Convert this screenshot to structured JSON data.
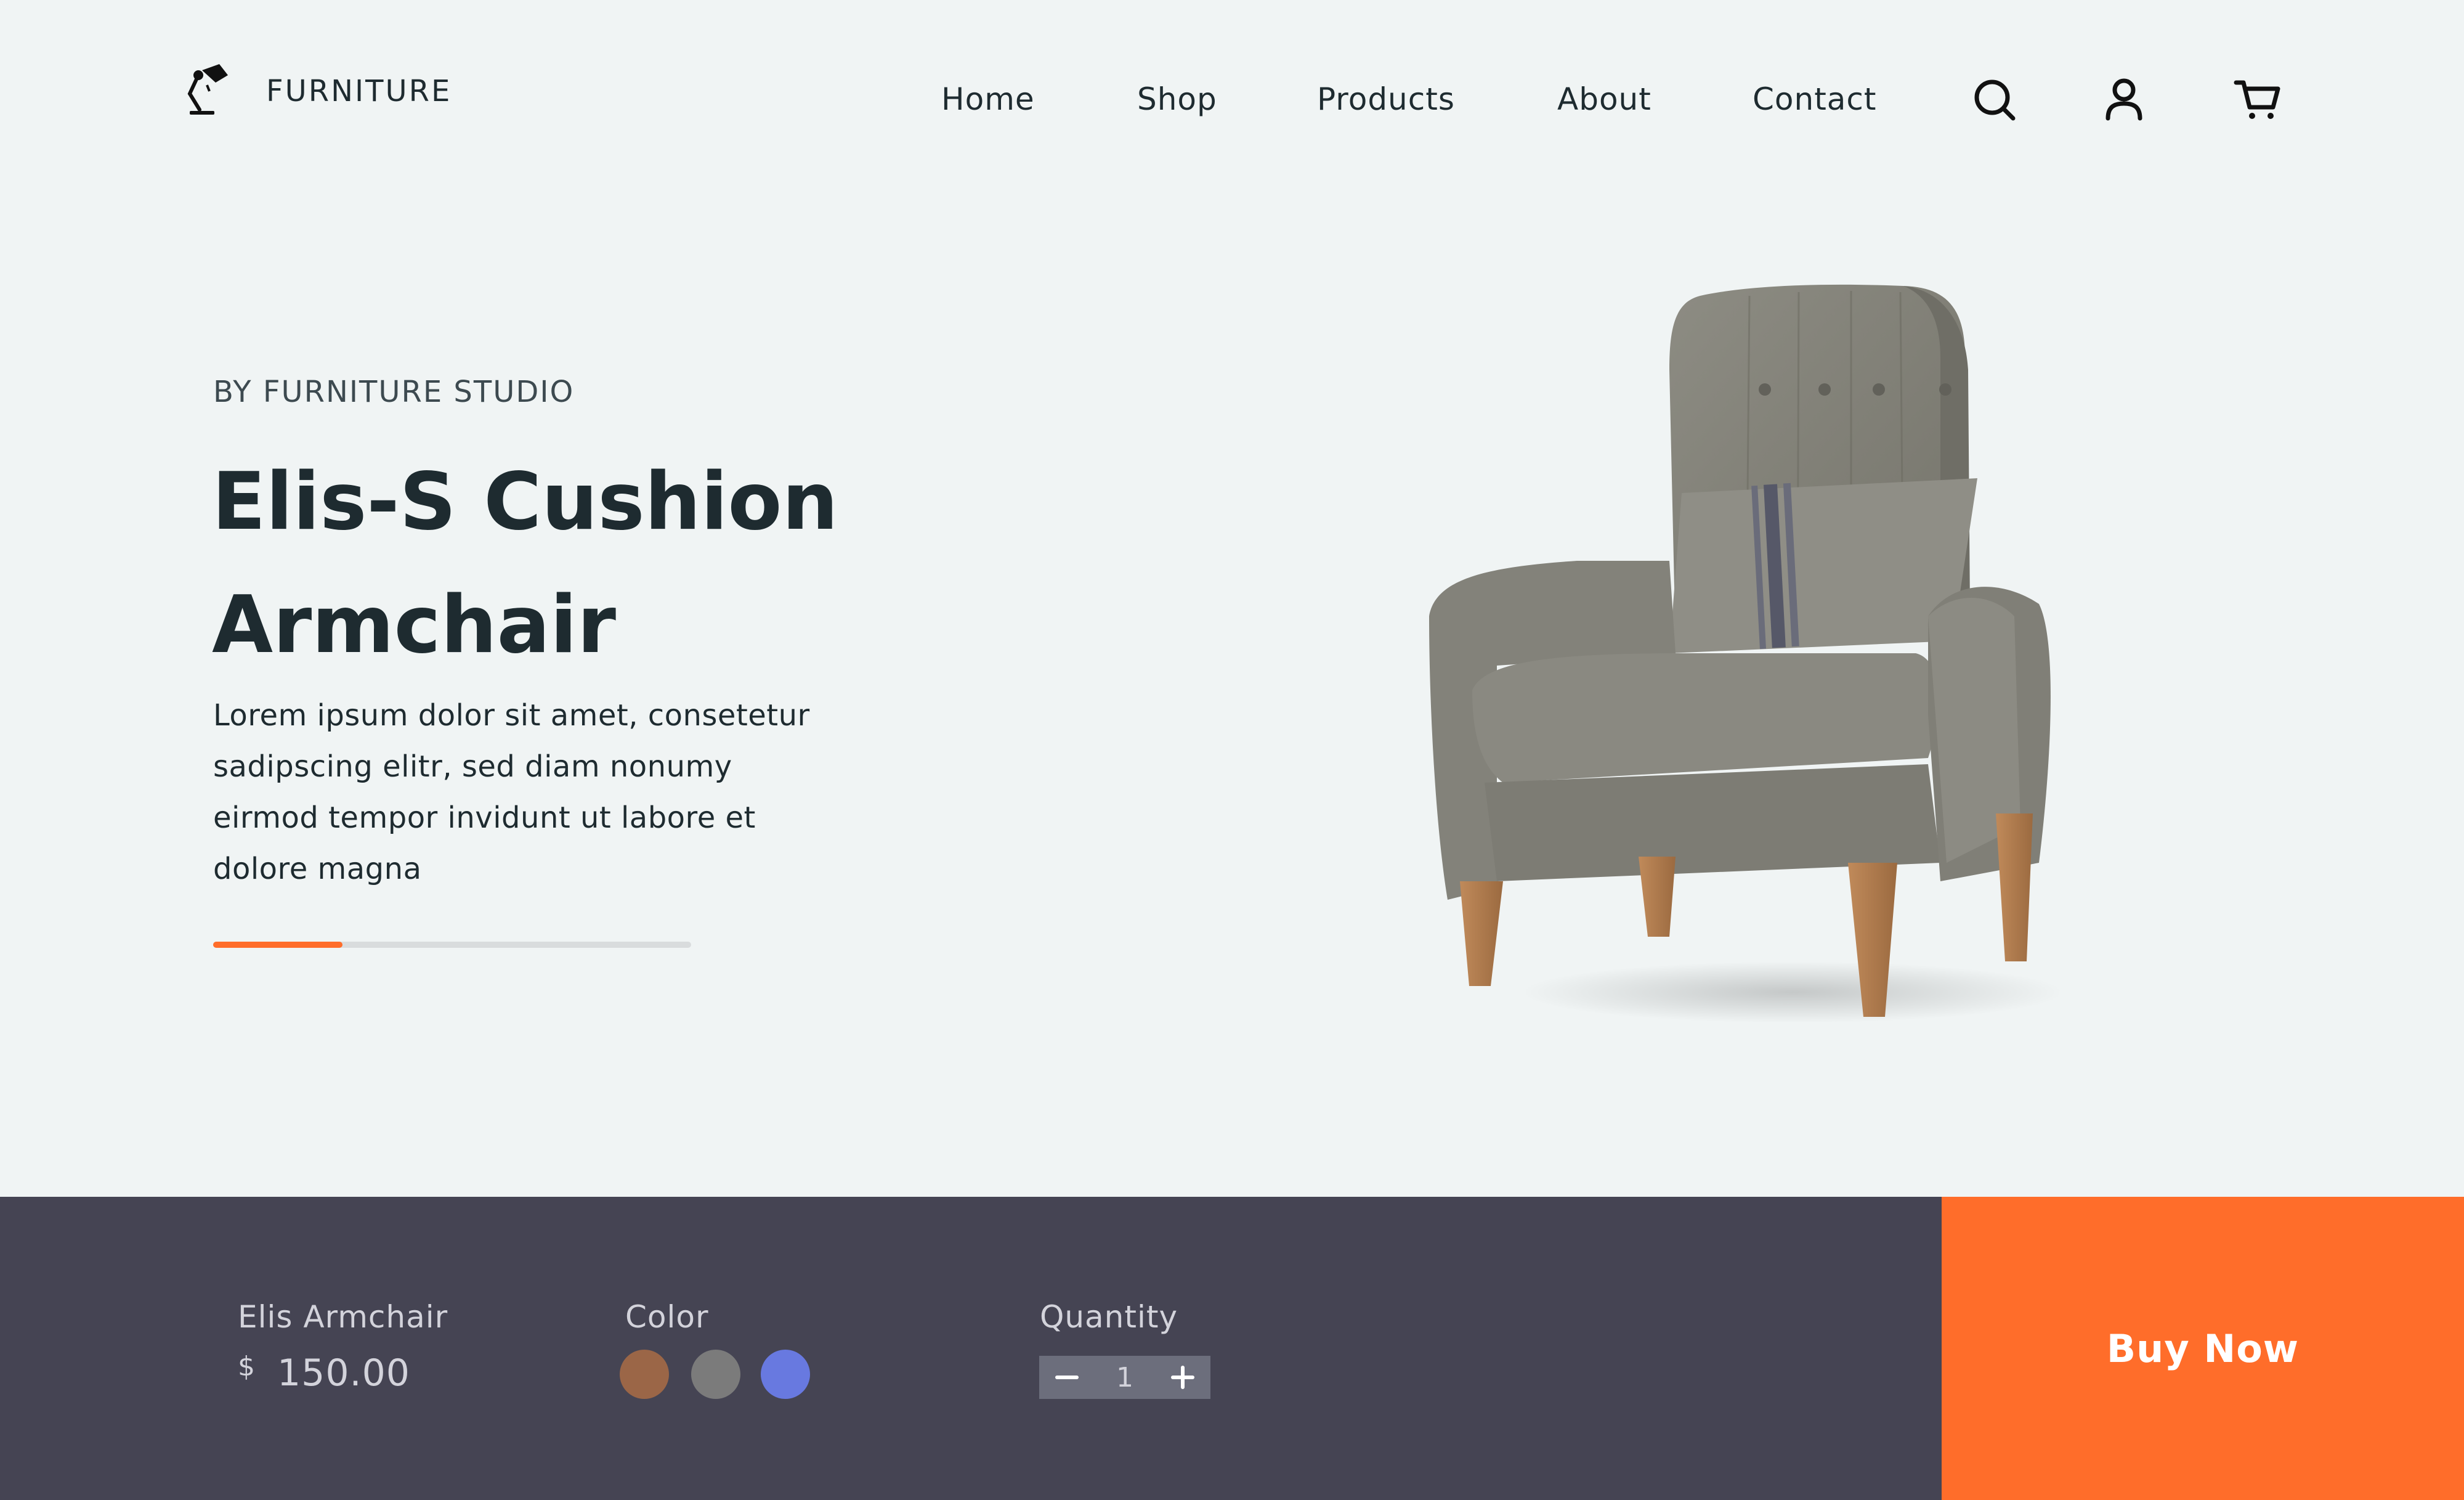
{
  "brand": {
    "name": "FURNITURE",
    "logo_icon": "desk-lamp-icon"
  },
  "nav": {
    "items": [
      {
        "label": "Home"
      },
      {
        "label": "Shop"
      },
      {
        "label": "Products"
      },
      {
        "label": "About"
      },
      {
        "label": "Contact"
      }
    ],
    "icons": [
      "search-icon",
      "user-icon",
      "cart-icon"
    ]
  },
  "hero": {
    "eyebrow": "BY FURNITURE STUDIO",
    "title_line1": "Elis-S Cushion",
    "title_line2": "Armchair",
    "description": "Lorem ipsum dolor sit amet, consetetur sadipscing elitr, sed diam nonumy eirmod tempor invidunt ut labore et dolore magna",
    "progress_fraction": 0.27
  },
  "product_bar": {
    "name": "Elis Armchair",
    "currency": "$",
    "price": "150.00",
    "color_label": "Color",
    "colors": [
      "#9b6647",
      "#7b7b7b",
      "#6879e0"
    ],
    "quantity_label": "Quantity",
    "quantity": "1",
    "buy_label": "Buy Now"
  },
  "colors": {
    "background": "#f0f4f4",
    "bar": "#454453",
    "accent": "#ff6d2a",
    "text": "#1e2b30"
  }
}
